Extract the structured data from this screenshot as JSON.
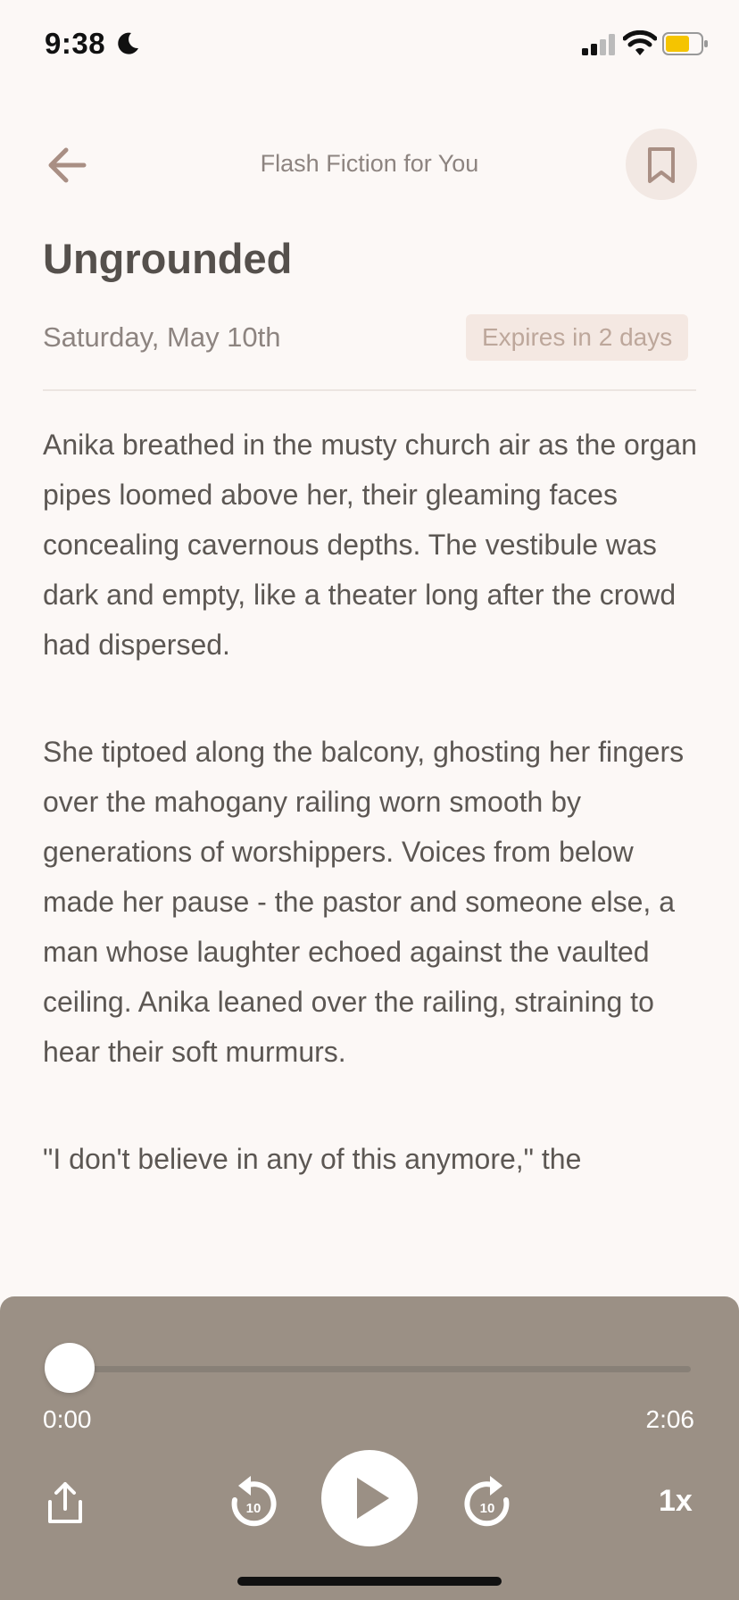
{
  "status_bar": {
    "time": "9:38",
    "icons": [
      "moon-icon",
      "cellular-signal-icon",
      "wifi-icon",
      "battery-icon"
    ],
    "battery_color": "#f5c400"
  },
  "header": {
    "title": "Flash Fiction for You",
    "back_icon": "arrow-left-icon",
    "bookmark_icon": "bookmark-icon"
  },
  "story": {
    "title": "Ungrounded",
    "date": "Saturday, May 10th",
    "expires": "Expires in 2 days",
    "paragraphs": [
      "Anika breathed in the musty church air as the organ pipes loomed above her, their gleaming faces concealing cavernous depths. The vestibule was dark and empty, like a theater long after the crowd had dispersed.",
      "She tiptoed along the balcony, ghosting her fingers over the mahogany railing worn smooth by generations of worshippers. Voices from below made her pause - the pastor and someone else, a man whose laughter echoed against the vaulted ceiling. Anika leaned over the railing, straining to hear their soft murmurs.",
      "\"I don't believe in any of this anymore,\" the"
    ]
  },
  "player": {
    "progress": 0,
    "elapsed": "0:00",
    "total": "2:06",
    "rewind_label": "10",
    "forward_label": "10",
    "speed": "1x",
    "background_color": "#9b9085",
    "icons": [
      "share-icon",
      "rewind-10-icon",
      "play-icon",
      "forward-10-icon"
    ]
  }
}
